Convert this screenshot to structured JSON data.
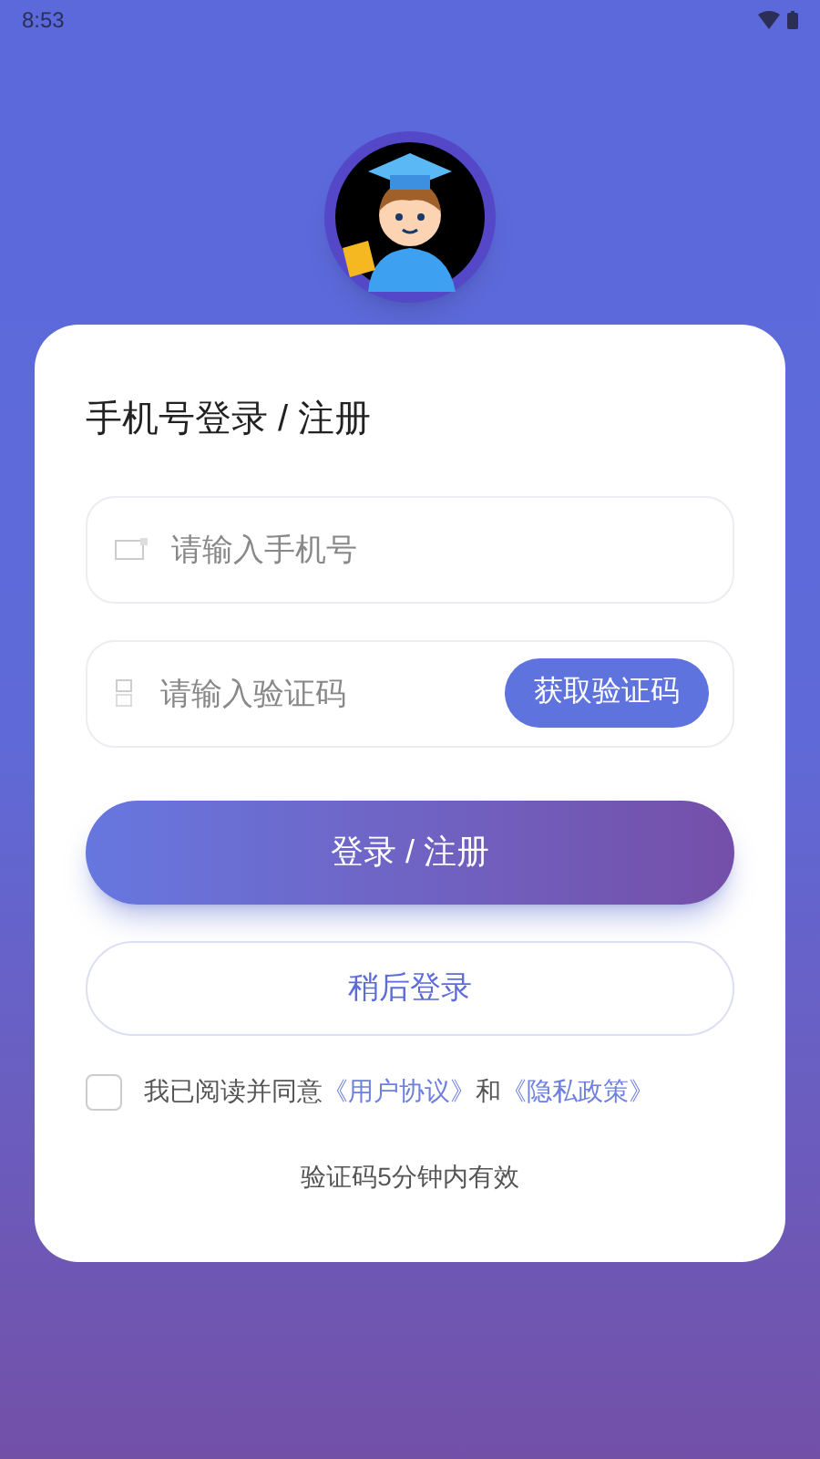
{
  "status_bar": {
    "time": "8:53"
  },
  "form": {
    "title": "手机号登录 / 注册",
    "phone_field": {
      "placeholder": "请输入手机号"
    },
    "code_field": {
      "placeholder": "请输入验证码",
      "button": "获取验证码"
    },
    "login_button": "登录 / 注册",
    "later_button": "稍后登录",
    "agreement": {
      "checked": false,
      "text": "我已阅读并同意",
      "user_agreement": "《用户协议》",
      "conjunction": "和",
      "privacy_policy": "《隐私政策》"
    },
    "note": "验证码5分钟内有效"
  }
}
